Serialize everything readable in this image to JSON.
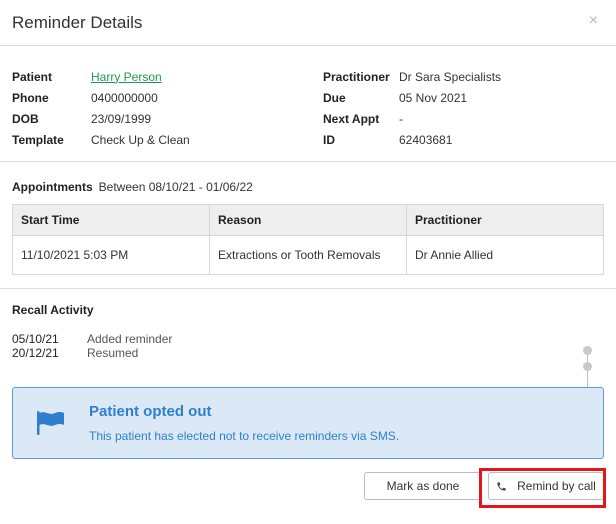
{
  "header": {
    "title": "Reminder Details",
    "close_glyph": "×"
  },
  "details": {
    "left": [
      {
        "label": "Patient",
        "value": "Harry Person",
        "link": true
      },
      {
        "label": "Phone",
        "value": "0400000000"
      },
      {
        "label": "DOB",
        "value": "23/09/1999"
      },
      {
        "label": "Template",
        "value": "Check Up & Clean"
      }
    ],
    "right": [
      {
        "label": "Practitioner",
        "value": "Dr Sara Specialists"
      },
      {
        "label": "Due",
        "value": "05 Nov 2021"
      },
      {
        "label": "Next Appt",
        "value": "-"
      },
      {
        "label": "ID",
        "value": "62403681"
      }
    ]
  },
  "appointments": {
    "label": "Appointments",
    "range": "Between 08/10/21 - 01/06/22",
    "columns": [
      "Start Time",
      "Reason",
      "Practitioner"
    ],
    "rows": [
      [
        "11/10/2021 5:03 PM",
        "Extractions or Tooth Removals",
        "Dr Annie Allied"
      ]
    ]
  },
  "recall": {
    "title": "Recall Activity",
    "items": [
      {
        "date": "05/10/21",
        "text": "Added reminder"
      },
      {
        "date": "20/12/21",
        "text": "Resumed"
      }
    ],
    "notice": {
      "icon": "flag-icon",
      "title": "Patient opted out",
      "text": "This patient has elected not to receive reminders via SMS."
    }
  },
  "footer": {
    "mark_done_label": "Mark as done",
    "remind_call_label": "Remind by call",
    "remind_call_icon": "phone-icon"
  },
  "colors": {
    "accent": "#2f7fcc",
    "notice_bg": "#dbe9f7",
    "link": "#1e9a52",
    "highlight": "#e8141b"
  }
}
